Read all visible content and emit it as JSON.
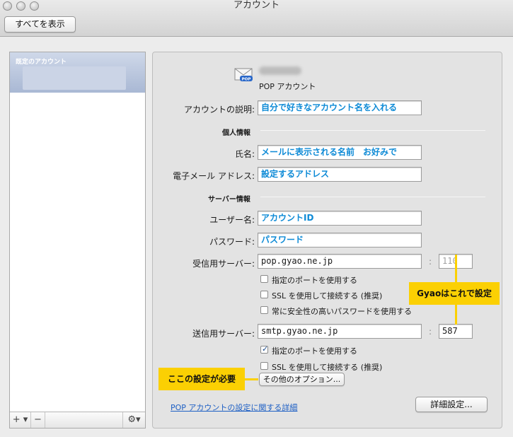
{
  "window": {
    "title": "アカウント"
  },
  "toolbar": {
    "show_all": "すべてを表示"
  },
  "accounts": {
    "header": "既定のアカウント",
    "add_label": "+ ▾",
    "remove_label": "−",
    "gear_label": "⚙▾"
  },
  "account": {
    "type_label": "POP アカウント",
    "description_label": "アカウントの説明:",
    "description_value": "自分で好きなアカウント名を入れる"
  },
  "personal": {
    "section": "個人情報",
    "name_label": "氏名:",
    "name_value": "メールに表示される名前　お好みで",
    "email_label": "電子メール アドレス:",
    "email_value": "設定するアドレス"
  },
  "server": {
    "section": "サーバー情報",
    "username_label": "ユーザー名:",
    "username_value": "アカウントID",
    "password_label": "パスワード:",
    "password_value": "パスワード",
    "incoming_label": "受信用サーバー:",
    "incoming_value": "pop.gyao.ne.jp",
    "incoming_port": "110",
    "colon": ":",
    "incoming_options": [
      {
        "label": "指定のポートを使用する",
        "checked": false
      },
      {
        "label": "SSL を使用して接続する (推奨)",
        "checked": false
      },
      {
        "label": "常に安全性の高いパスワードを使用する",
        "checked": false
      }
    ],
    "outgoing_label": "送信用サーバー:",
    "outgoing_value": "smtp.gyao.ne.jp",
    "outgoing_port": "587",
    "outgoing_options": [
      {
        "label": "指定のポートを使用する",
        "checked": true
      },
      {
        "label": "SSL を使用して接続する (推奨)",
        "checked": false
      }
    ],
    "other_options_button": "その他のオプション..."
  },
  "footer": {
    "help_link": "POP アカウントの設定に関する詳細",
    "advanced_button": "詳細設定..."
  },
  "annotations": {
    "gyao": "Gyaoはこれで設定",
    "required": "ここの設定が必要"
  },
  "colors": {
    "annotation": "#fbd003",
    "annotation_text_blue": "#0d8ad6",
    "selection": "#b4c2dc"
  }
}
